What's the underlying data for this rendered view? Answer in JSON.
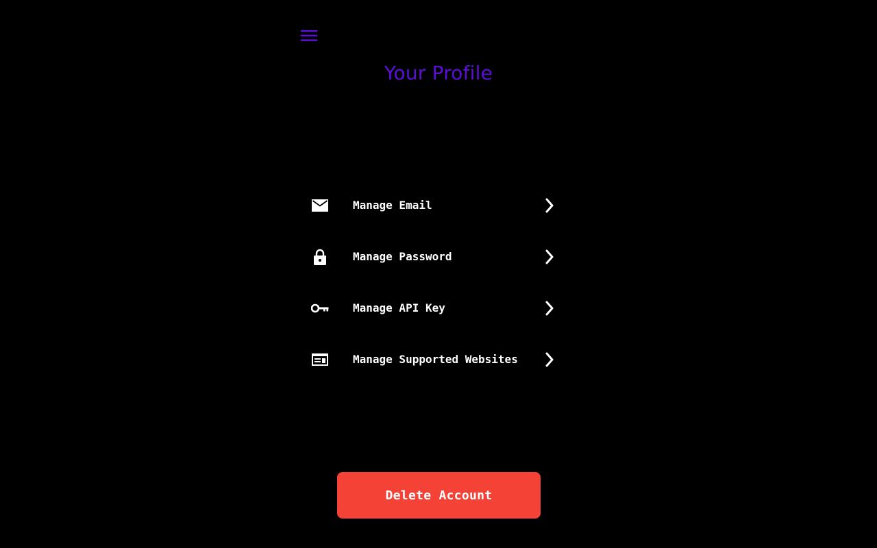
{
  "colors": {
    "background": "#000000",
    "accent": "#5B0FD6",
    "text": "#FFFFFF",
    "danger": "#F44336"
  },
  "header": {
    "menu_icon": "hamburger-menu-icon",
    "title": "Your Profile"
  },
  "menu": {
    "items": [
      {
        "label": "Manage Email",
        "icon": "email-icon"
      },
      {
        "label": "Manage Password",
        "icon": "lock-icon"
      },
      {
        "label": "Manage API Key",
        "icon": "key-icon"
      },
      {
        "label": "Manage Supported Websites",
        "icon": "web-icon"
      }
    ],
    "chevron_icon": "chevron-right-icon"
  },
  "actions": {
    "delete_label": "Delete Account"
  }
}
